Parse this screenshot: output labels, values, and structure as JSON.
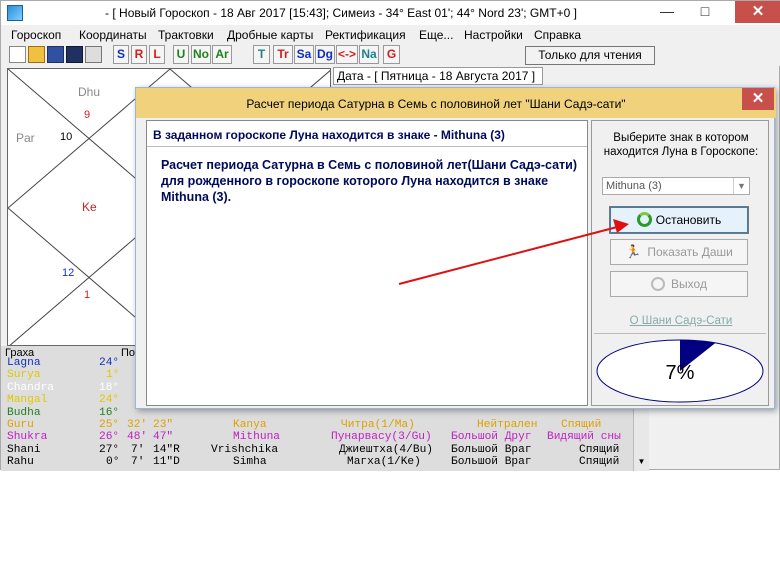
{
  "window": {
    "title": "- [ Новый Гороскоп - 18 Авг 2017 [15:43]; Симеиз - 34° East 01'; 44° Nord 23'; GMT+0 ]",
    "minimize": "—",
    "maximize": "□",
    "close": "✕"
  },
  "menu": [
    "Гороскоп",
    "Координаты",
    "Трактовки",
    "Дробные карты",
    "Ректификация",
    "Еще...",
    "Настройки",
    "Справка"
  ],
  "toolbar": {
    "buttons": [
      {
        "label": "S",
        "color": "#1030c0"
      },
      {
        "label": "R",
        "color": "#d02020"
      },
      {
        "label": "L",
        "color": "#d02020"
      },
      {
        "label": "U",
        "color": "#208020"
      },
      {
        "label": "No",
        "color": "#208020"
      },
      {
        "label": "Ar",
        "color": "#208020"
      },
      {
        "label": "T",
        "color": "#208090"
      },
      {
        "label": "Tr",
        "color": "#d02020"
      },
      {
        "label": "Sa",
        "color": "#1030c0"
      },
      {
        "label": "Dg",
        "color": "#1030c0"
      },
      {
        "label": "<->",
        "color": "#d02020"
      },
      {
        "label": "Na",
        "color": "#208090"
      },
      {
        "label": "G",
        "color": "#d02020"
      }
    ],
    "readonly_label": "Только для чтения"
  },
  "date_bar": "Дата - [ Пятница    - 18 Августа  2017 ]",
  "chart": {
    "labels": [
      {
        "text": "Dhu",
        "color": "#888888"
      },
      {
        "text": "9",
        "color": "#d02020"
      },
      {
        "text": "Par",
        "color": "#888888"
      },
      {
        "text": "10",
        "color": "#000000"
      },
      {
        "text": "Ke",
        "color": "#d02020"
      },
      {
        "text": "12",
        "color": "#1030c0"
      },
      {
        "text": "1",
        "color": "#d02020"
      }
    ]
  },
  "grid": {
    "header": [
      "Граха",
      "По"
    ],
    "rows": [
      {
        "name": "Lagna",
        "deg": "24°",
        "min": "",
        "sec": "",
        "sign": "",
        "nak": "",
        "status": "",
        "extra": "",
        "color": "#1030c0"
      },
      {
        "name": "Surya",
        "deg": "1°",
        "min": "",
        "sec": "",
        "sign": "",
        "nak": "",
        "status": "",
        "extra": "",
        "color": "#e0c800"
      },
      {
        "name": "Chandra",
        "deg": "18°",
        "min": "",
        "sec": "",
        "sign": "",
        "nak": "",
        "status": "",
        "extra": "",
        "color": "#ffffff"
      },
      {
        "name": "Mangal",
        "deg": "24°",
        "min": "",
        "sec": "",
        "sign": "",
        "nak": "",
        "status": "",
        "extra": "",
        "color": "#e0c800"
      },
      {
        "name": "Budha",
        "deg": "16°",
        "min": "",
        "sec": "",
        "sign": "",
        "nak": "",
        "status": "",
        "extra": "",
        "color": "#208020"
      },
      {
        "name": "Guru",
        "deg": "25°",
        "min": "32'",
        "sec": "23\"",
        "sign": "Kanya",
        "nak": "Читра(1/Ma)",
        "status": "Нейтрален",
        "extra": "Спящий",
        "color": "#e0a000"
      },
      {
        "name": "Shukra",
        "deg": "26°",
        "min": "48'",
        "sec": "47\"",
        "sign": "Mithuna",
        "nak": "Пунарвасу(3/Gu)",
        "status": "Большой Друг",
        "extra": "Видящий сны",
        "color": "#c020c0"
      },
      {
        "name": "Shani",
        "deg": "27°",
        "min": "7'",
        "sec": "14\"R",
        "sign": "Vrishchika",
        "nak": "Джиештха(4/Bu)",
        "status": "Большой Враг",
        "extra": "Спящий",
        "color": "#000000"
      },
      {
        "name": "Rahu",
        "deg": "0°",
        "min": "7'",
        "sec": "11\"D",
        "sign": "Simha",
        "nak": "Магха(1/Ke)",
        "status": "Большой Враг",
        "extra": "Спящий",
        "color": "#000000"
      }
    ]
  },
  "dialog": {
    "title": "Расчет периода Сатурна в Семь с половиной лет \"Шани Садэ-сати\"",
    "close": "✕",
    "header": "В заданном гороскопе Луна находится в знаке - Mithuna (3)",
    "body": "Расчет периода Сатурна в Семь с половиной лет(Шани Садэ-сати) для рожденного в гороскопе которого Луна находится в знаке Mithuna (3).",
    "right_label": "Выберите знак в котором находится Луна в Гороскопе:",
    "combo_value": "Mithuna (3)",
    "buttons": {
      "stop": "Остановить",
      "dasha": "Показать Даши",
      "exit": "Выход"
    },
    "link": "О Шани Садэ-Сати",
    "progress_text": "7%",
    "progress_value": 7
  }
}
